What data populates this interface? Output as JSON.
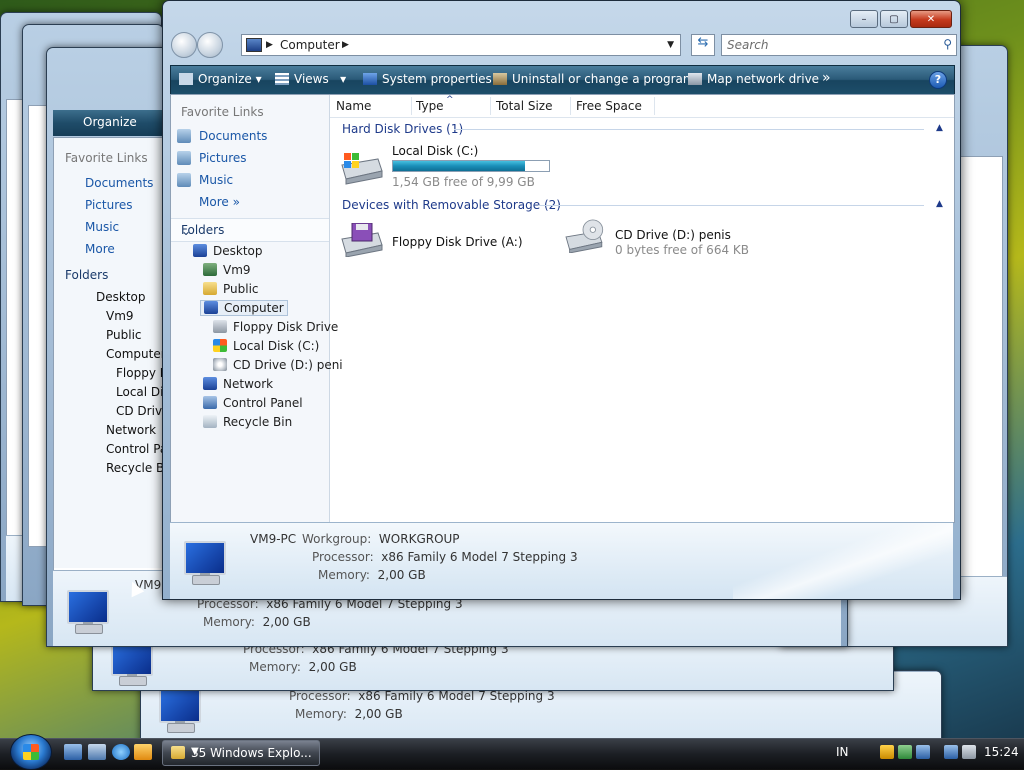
{
  "window": {
    "address": "Computer",
    "search_placeholder": "Search",
    "minimize": "–",
    "maximize": "▢",
    "close": "✕"
  },
  "toolbar": {
    "organize": "Organize",
    "views": "Views",
    "system_properties": "System properties",
    "uninstall": "Uninstall or change a program",
    "map_drive": "Map network drive",
    "more": "»",
    "help": "?"
  },
  "sidebar": {
    "favorite_links_title": "Favorite Links",
    "links": [
      {
        "label": "Documents",
        "icon": "documents-icon"
      },
      {
        "label": "Pictures",
        "icon": "pictures-icon"
      },
      {
        "label": "Music",
        "icon": "music-icon"
      }
    ],
    "more": "More",
    "folders_title": "Folders",
    "tree": [
      {
        "label": "Desktop",
        "icon": "desktop-icon",
        "level": 0
      },
      {
        "label": "Vm9",
        "icon": "user-folder-icon",
        "level": 1
      },
      {
        "label": "Public",
        "icon": "folder-icon",
        "level": 1
      },
      {
        "label": "Computer",
        "icon": "computer-icon",
        "level": 1,
        "selected": true
      },
      {
        "label": "Floppy Disk Drive",
        "icon": "floppy-icon",
        "level": 2
      },
      {
        "label": "Local Disk (C:)",
        "icon": "local-disk-icon",
        "level": 2
      },
      {
        "label": "CD Drive (D:) peni",
        "icon": "cd-drive-icon",
        "level": 2
      },
      {
        "label": "Network",
        "icon": "network-icon",
        "level": 1
      },
      {
        "label": "Control Panel",
        "icon": "control-panel-icon",
        "level": 1
      },
      {
        "label": "Recycle Bin",
        "icon": "recycle-bin-icon",
        "level": 1
      }
    ]
  },
  "columns": [
    "Name",
    "Type",
    "Total Size",
    "Free Space"
  ],
  "groups": [
    {
      "title": "Hard Disk Drives (1)",
      "items": [
        {
          "name": "Local Disk (C:)",
          "sub": "1,54 GB free of 9,99 GB",
          "used_fraction": 0.846,
          "icon": "hard-disk-icon"
        }
      ]
    },
    {
      "title": "Devices with Removable Storage (2)",
      "items": [
        {
          "name": "Floppy Disk Drive (A:)",
          "sub": "",
          "icon": "floppy-drive-icon"
        },
        {
          "name": "CD Drive (D:) penis",
          "sub": "0 bytes free of 664 KB",
          "icon": "cd-drive-icon"
        }
      ]
    }
  ],
  "details": {
    "pc_name": "VM9-PC",
    "workgroup_key": "Workgroup:",
    "workgroup_val": "WORKGROUP",
    "processor_key": "Processor:",
    "processor_val": "x86 Family 6 Model 7 Stepping 3",
    "memory_key": "Memory:",
    "memory_val": "2,00 GB"
  },
  "background_windows": {
    "organize": "Organize",
    "favorite_links_title": "Favorite Links",
    "links": [
      "Documents",
      "Pictures",
      "Music"
    ],
    "more": "More",
    "folders_title": "Folders",
    "tree": [
      "Desktop",
      "Vm9",
      "Public",
      "Computer",
      "Floppy D",
      "Local Dis",
      "CD Drive",
      "Network",
      "Control Pa",
      "Recycle Bin"
    ],
    "pc_name_partial": "VM9",
    "processor_key": "Processor:",
    "processor_val": "x86 Family 6 Model 7 Stepping 3",
    "memory_key": "Memory:",
    "memory_val": "2,00 GB"
  },
  "taskbar": {
    "task_label": "35 Windows Explo...",
    "language": "IN",
    "clock": "15:24"
  }
}
